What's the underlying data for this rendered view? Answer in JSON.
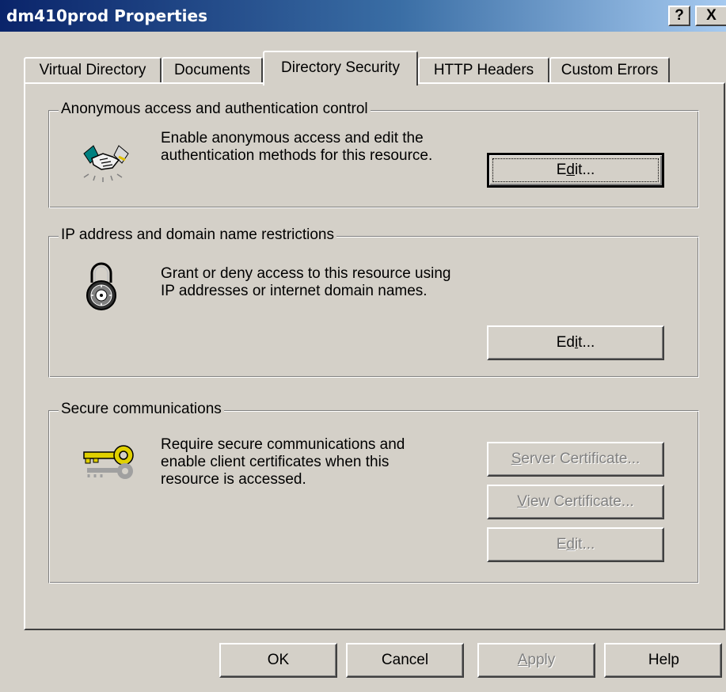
{
  "window": {
    "title": "dm410prod Properties",
    "help_button": "?",
    "close_button": "X"
  },
  "tabs": [
    {
      "label": "Virtual Directory",
      "active": false
    },
    {
      "label": "Documents",
      "active": false
    },
    {
      "label": "Directory Security",
      "active": true
    },
    {
      "label": "HTTP Headers",
      "active": false
    },
    {
      "label": "Custom Errors",
      "active": false
    }
  ],
  "anonymous": {
    "legend": "Anonymous access and authentication control",
    "desc_line1": "Enable anonymous access and edit the",
    "desc_line2": "authentication methods for this resource.",
    "icon": "handshake-icon",
    "edit_pre": "E",
    "edit_u": "d",
    "edit_post": "it..."
  },
  "ip": {
    "legend": "IP address and domain name restrictions",
    "desc_line1": "Grant or deny access to this resource using",
    "desc_line2": "IP addresses or internet domain names.",
    "icon": "combination-lock-icon",
    "edit_pre": "Ed",
    "edit_u": "i",
    "edit_post": "t..."
  },
  "secure": {
    "legend": "Secure communications",
    "desc_line1": "Require secure communications and",
    "desc_line2": "enable client certificates when this",
    "desc_line3": "resource is accessed.",
    "icon": "key-icon",
    "server_cert_u": "S",
    "server_cert_post": "erver Certificate...",
    "view_cert_u": "V",
    "view_cert_post": "iew Certificate...",
    "edit_pre": "E",
    "edit_u": "d",
    "edit_post": "it..."
  },
  "footer": {
    "ok": "OK",
    "cancel": "Cancel",
    "apply_u": "A",
    "apply_post": "pply",
    "help": "Help"
  },
  "colors": {
    "face": "#d4d0c8",
    "titlebar_start": "#0a246a",
    "titlebar_end": "#a6caf0",
    "disabled_text": "#808080"
  }
}
